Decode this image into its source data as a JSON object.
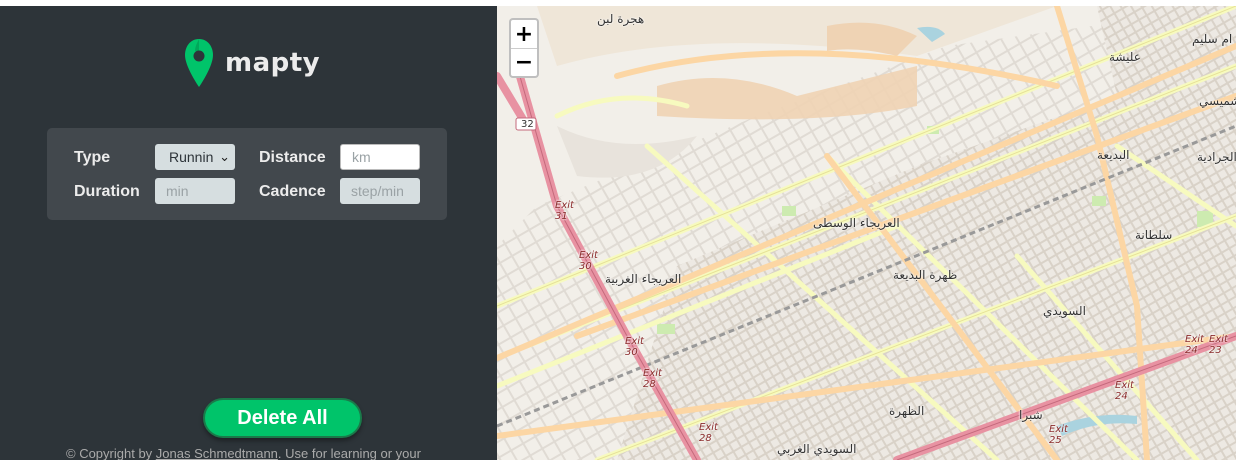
{
  "sidebar": {
    "logo_text": "mapty",
    "form": {
      "type_label": "Type",
      "type_value": "Running",
      "distance_label": "Distance",
      "distance_placeholder": "km",
      "duration_label": "Duration",
      "duration_placeholder": "min",
      "cadence_label": "Cadence",
      "cadence_placeholder": "step/min"
    },
    "delete_all_label": "Delete All",
    "copyright_prefix": "© Copyright by ",
    "copyright_author": "Jonas Schmedtmann",
    "copyright_suffix": ". Use for learning or your"
  },
  "map": {
    "zoom_in": "+",
    "zoom_out": "−",
    "labels": [
      {
        "text": "هجرة لبن"
      },
      {
        "text": "عليشة"
      },
      {
        "text": "ام سليم"
      },
      {
        "text": "شميسي"
      },
      {
        "text": "البديعة"
      },
      {
        "text": "الجرادية"
      },
      {
        "text": "سلطانة"
      },
      {
        "text": "العريجاء الوسطى"
      },
      {
        "text": "العريجاء الغربية"
      },
      {
        "text": "ظهرة البديعة"
      },
      {
        "text": "السويدي"
      },
      {
        "text": "الظهرة"
      },
      {
        "text": "شبرا"
      },
      {
        "text": "السويدي الغربي"
      }
    ],
    "exits": [
      "Exit 31",
      "Exit 30",
      "Exit 30",
      "Exit 28",
      "Exit 28",
      "Exit 24",
      "Exit 24",
      "Exit 25",
      "Exit 23"
    ],
    "shields": [
      "32"
    ],
    "colors": {
      "background": "#f2efe9",
      "highway": "#e892a2",
      "primary": "#fcd6a4",
      "secondary": "#f7fabf",
      "brand_green": "#00c46a",
      "sidebar_bg": "#2d3439"
    }
  }
}
